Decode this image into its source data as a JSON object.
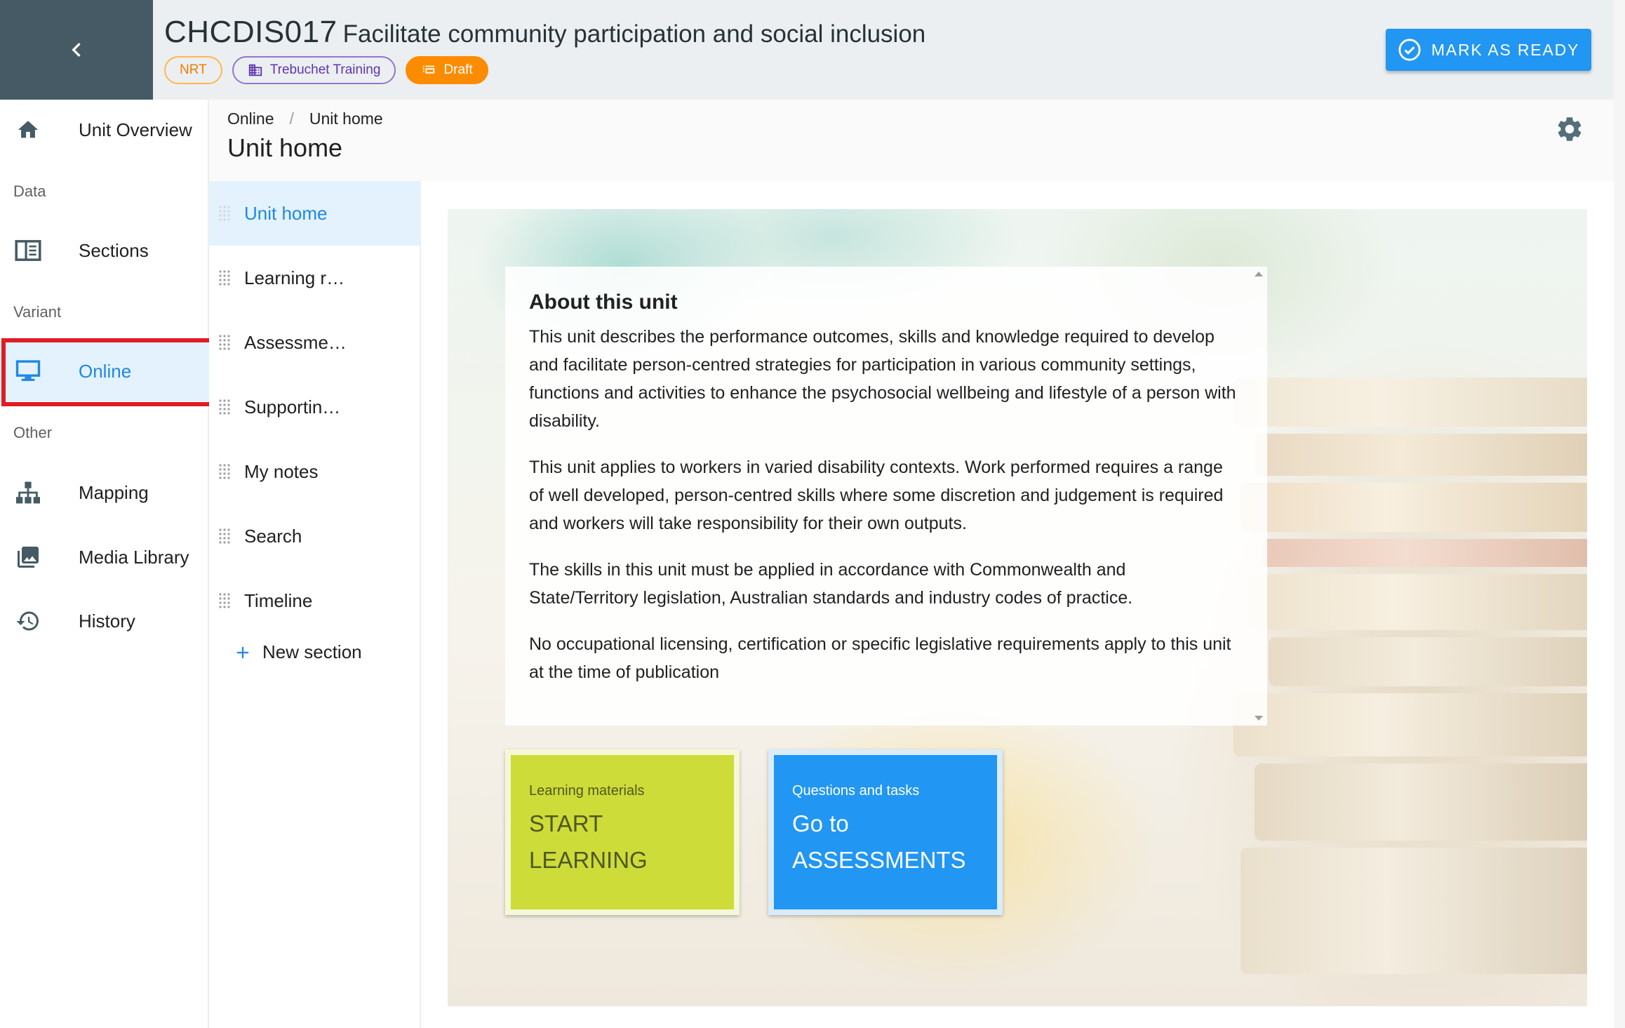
{
  "header": {
    "unit_code": "CHCDIS017",
    "unit_title": "Facilitate community participation and social inclusion",
    "chips": {
      "nrt": "NRT",
      "provider": "Trebuchet Training",
      "status": "Draft"
    },
    "mark_ready_label": "MARK AS READY"
  },
  "leftnav": {
    "overview": "Unit Overview",
    "group_data": "Data",
    "sections": "Sections",
    "group_variant": "Variant",
    "online": "Online",
    "group_other": "Other",
    "mapping": "Mapping",
    "media_library": "Media Library",
    "history": "History"
  },
  "breadcrumb": {
    "items": [
      "Online",
      "Unit home"
    ],
    "separator": "/"
  },
  "page_title": "Unit home",
  "section_list": {
    "items": [
      "Unit home",
      "Learning r…",
      "Assessme…",
      "Supportin…",
      "My notes",
      "Search",
      "Timeline"
    ],
    "new_section_label": "New section"
  },
  "about": {
    "title": "About this unit",
    "paragraphs": [
      "This unit describes the performance outcomes, skills and knowledge required to develop and facilitate person-centred strategies for participation in various community settings, functions and activities to enhance the psychosocial wellbeing and lifestyle of a person with disability.",
      "This unit applies to workers in varied disability contexts. Work performed requires a range of well developed, person-centred skills where some discretion and judgement is required and workers will take responsibility for their own outputs.",
      "The skills in this unit must be applied in accordance with Commonwealth and State/Territory legislation, Australian standards and industry codes of practice.",
      "No occupational licensing, certification or specific legislative requirements apply to this unit at the time of publication"
    ]
  },
  "tiles": {
    "learning": {
      "sub": "Learning materials",
      "line1": "START",
      "line2": "LEARNING"
    },
    "assessments": {
      "sub": "Questions and tasks",
      "line1": "Go to",
      "line2": "ASSESSMENTS"
    }
  },
  "colors": {
    "accent": "#2196f3",
    "active_text": "#1e88e5",
    "active_bg": "#e3f2fd",
    "header_dark": "#455a64",
    "draft": "#fb8c00",
    "learning_tile": "#cddc39",
    "highlight": "#e01c24"
  }
}
